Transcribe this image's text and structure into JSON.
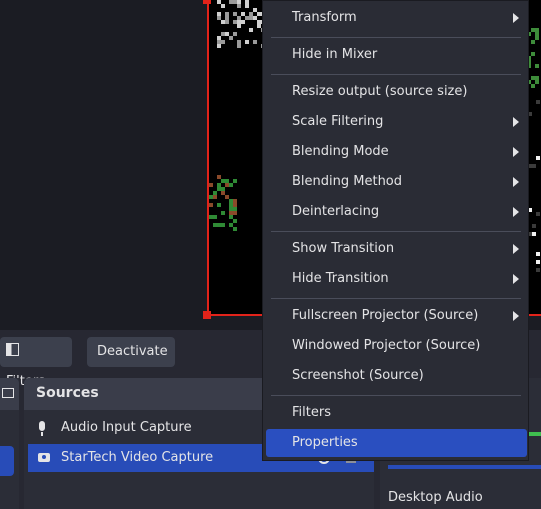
{
  "toolbar": {
    "filters_label": "Filters",
    "deactivate_label": "Deactivate"
  },
  "sources": {
    "title": "Sources",
    "items": [
      {
        "label": "Audio Input Capture",
        "icon": "microphone-icon"
      },
      {
        "label": "StarTech Video Capture",
        "icon": "camera-icon",
        "selected": true
      }
    ]
  },
  "mixer": {
    "desktop_audio_label": "Desktop Audio"
  },
  "context_menu": {
    "items": [
      {
        "label": "Transform",
        "submenu": true
      },
      {
        "label": "Hide in Mixer",
        "submenu": false
      },
      {
        "label": "Resize output (source size)",
        "submenu": false
      },
      {
        "label": "Scale Filtering",
        "submenu": true
      },
      {
        "label": "Blending Mode",
        "submenu": true
      },
      {
        "label": "Blending Method",
        "submenu": true
      },
      {
        "label": "Deinterlacing",
        "submenu": true
      },
      {
        "label": "Show Transition",
        "submenu": true
      },
      {
        "label": "Hide Transition",
        "submenu": true
      },
      {
        "label": "Fullscreen Projector (Source)",
        "submenu": true
      },
      {
        "label": "Windowed Projector (Source)",
        "submenu": false
      },
      {
        "label": "Screenshot (Source)",
        "submenu": false
      },
      {
        "label": "Filters",
        "submenu": false
      },
      {
        "label": "Properties",
        "submenu": false,
        "highlighted": true
      }
    ]
  },
  "colors": {
    "accent": "#284cb8",
    "selection_border": "#e2231a",
    "menu_bg": "#2a2c35"
  }
}
